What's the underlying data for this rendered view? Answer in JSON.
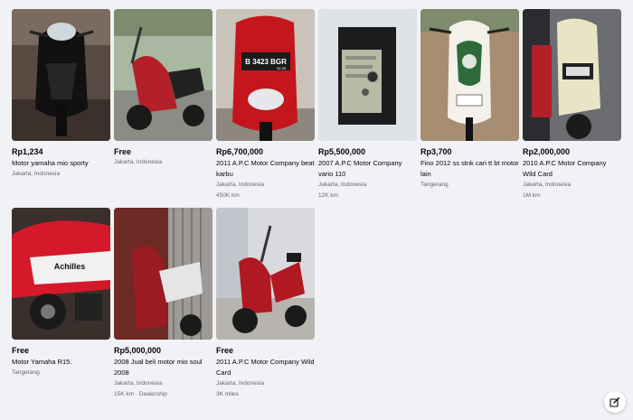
{
  "listings": [
    {
      "price": "Rp1,234",
      "title": "Motor yamaha mio sporty",
      "location": "Jakarta, Indonesia",
      "extra": ""
    },
    {
      "price": "Free",
      "title": "",
      "location": "Jakarta, Indonesia",
      "extra": ""
    },
    {
      "price": "Rp6,700,000",
      "title": "2011 A.P.C Motor Company beat karbu",
      "location": "Jakarta, Indonesia",
      "extra": "450K km"
    },
    {
      "price": "Rp5,500,000",
      "title": "2007 A.P.C Motor Company vario 110",
      "location": "Jakarta, Indonesia",
      "extra": "12K km"
    },
    {
      "price": "Rp3,700",
      "title": "Fino 2012 ss stnk cari tt bt motor lain",
      "location": "Tangerang",
      "extra": ""
    },
    {
      "price": "Rp2,000,000",
      "title": "2010 A.P.C Motor Company Wild Card",
      "location": "Jakarta, Indonesia",
      "extra": "1M km"
    },
    {
      "price": "Free",
      "title": "Motor Yamaha R15.",
      "location": "Tangerang",
      "extra": ""
    },
    {
      "price": "Rp5,000,000",
      "title": "2008 Jual beli motor mio soul 2008",
      "location": "Jakarta, Indonesia",
      "extra": "15K km · Dealership"
    },
    {
      "price": "Free",
      "title": "2011 A.P.C Motor Company Wild Card",
      "location": "Jakarta, Indonesia",
      "extra": "3K miles"
    }
  ],
  "plate_texts": {
    "listing_3": "B 3423 BGR",
    "listing_3_date": "03·28"
  },
  "decal_texts": {
    "listing_7": "Achilles"
  },
  "fab": {
    "icon": "edit-icon"
  }
}
